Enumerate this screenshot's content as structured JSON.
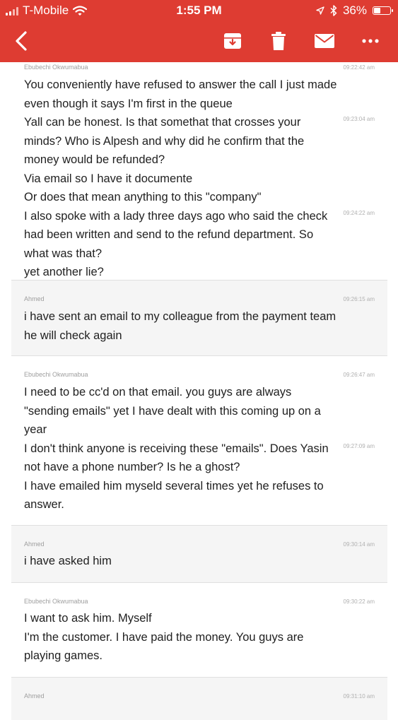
{
  "status_bar": {
    "carrier": "T-Mobile",
    "time": "1:55 PM",
    "battery": "36%",
    "battery_level": 0.36
  },
  "toolbar": {
    "icons": [
      "back-icon",
      "archive-icon",
      "trash-icon",
      "mail-icon",
      "more-icon"
    ]
  },
  "colors": {
    "header": "#de3c32",
    "alt_row": "#f5f5f5"
  },
  "messages": [
    {
      "sender": "Ebubechi Okwumabua",
      "lines": [
        "You conveniently have refused to answer the call I just made",
        "even though it says I'm first in the queue",
        "Yall can be honest. Is that somethat that crosses your",
        "minds? Who is Alpesh and why did he confirm that the",
        "money would be refunded?",
        "Via email so I have it documente",
        "Or does that mean anything to this \"company\"",
        "I also spoke with a lady three days ago who said the check",
        "had been written and send to the refund department. So",
        "what was that?",
        "yet another lie?"
      ],
      "timestamps": [
        "09:22:42 am",
        "09:23:04 am",
        "09:24:22 am"
      ]
    },
    {
      "sender": "Ahmed",
      "lines": [
        "i have sent an email to my colleague from the payment team",
        "he will check again"
      ],
      "timestamps": [
        "09:26:15 am"
      ]
    },
    {
      "sender": "Ebubechi Okwumabua",
      "lines": [
        "I need to be cc'd on that email. you guys are always",
        "\"sending emails\" yet I have dealt with this coming up on a",
        "year",
        "I don't think anyone is receiving these \"emails\". Does Yasin",
        "not have a phone number? Is he a ghost?",
        "I have emailed him myseld several times yet he refuses to",
        "answer."
      ],
      "timestamps": [
        "09:26:47 am",
        "09:27:09 am"
      ]
    },
    {
      "sender": "Ahmed",
      "lines": [
        "i have asked him"
      ],
      "timestamps": [
        "09:30:14 am"
      ]
    },
    {
      "sender": "Ebubechi Okwumabua",
      "lines": [
        "I want to ask him. Myself",
        "I'm the customer. I have paid the money. You guys are",
        "playing games."
      ],
      "timestamps": [
        "09:30:22 am"
      ]
    },
    {
      "sender": "Ahmed",
      "lines": [],
      "timestamps": [
        "09:31:10 am"
      ]
    }
  ]
}
